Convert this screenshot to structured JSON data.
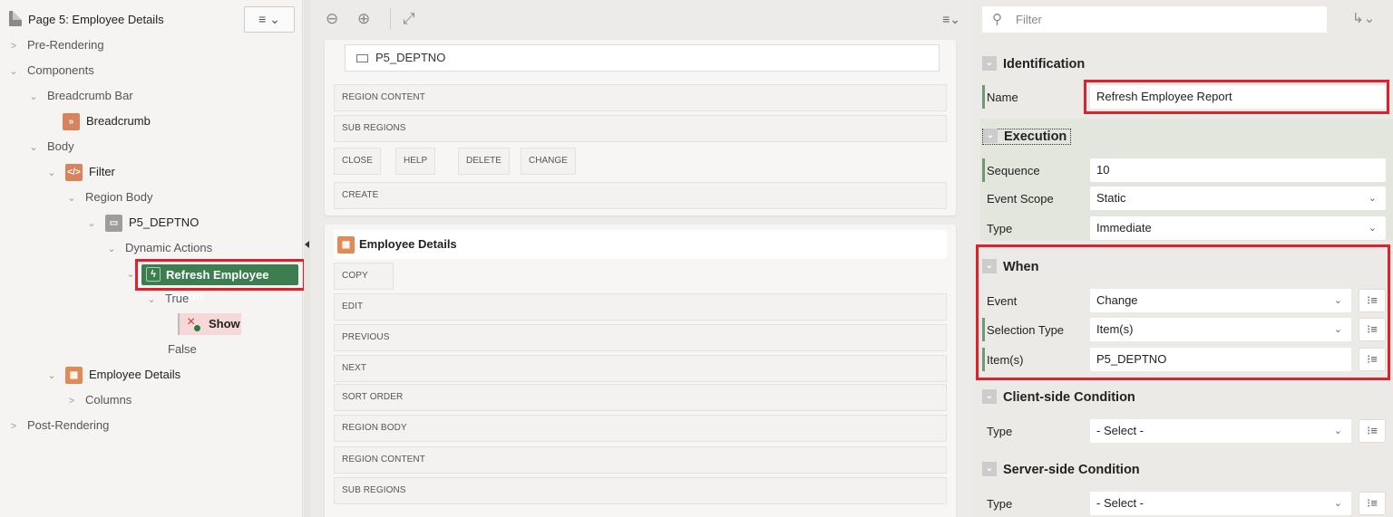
{
  "left": {
    "page_title": "Page 5: Employee Details",
    "menu_icon": "hamburger-chevron-icon",
    "tree": {
      "pre_rendering": "Pre-Rendering",
      "components": "Components",
      "breadcrumb_bar": "Breadcrumb Bar",
      "breadcrumb": "Breadcrumb",
      "body": "Body",
      "filter": "Filter",
      "region_body": "Region Body",
      "p5_deptno": "P5_DEPTNO",
      "dynamic_actions": "Dynamic Actions",
      "refresh_employee_report": "Refresh Employee Report",
      "true": "True",
      "show": "Show",
      "false": "False",
      "employee_details": "Employee Details",
      "columns": "Columns",
      "post_rendering": "Post-Rendering"
    }
  },
  "mid": {
    "toolbar": {
      "zoom_out": "⊖",
      "zoom_in": "⊕",
      "expand": "⤢",
      "menu": "≡⌄"
    },
    "region1": {
      "item": "P5_DEPTNO",
      "slots": {
        "region_content": "REGION CONTENT",
        "sub_regions": "SUB REGIONS",
        "create": "CREATE"
      },
      "buttons": {
        "close": "CLOSE",
        "help": "HELP",
        "delete": "DELETE",
        "change": "CHANGE"
      }
    },
    "region2": {
      "title": "Employee Details",
      "slots": {
        "copy": "COPY",
        "edit": "EDIT",
        "previous": "PREVIOUS",
        "next": "NEXT",
        "sort_order": "SORT ORDER",
        "region_body": "REGION BODY",
        "region_content": "REGION CONTENT",
        "sub_regions": "SUB REGIONS"
      }
    }
  },
  "right": {
    "filter_placeholder": "Filter",
    "identification": {
      "title": "Identification",
      "name_label": "Name",
      "name_value": "Refresh Employee Report"
    },
    "execution": {
      "title": "Execution",
      "sequence_label": "Sequence",
      "sequence_value": "10",
      "event_scope_label": "Event Scope",
      "event_scope_value": "Static",
      "type_label": "Type",
      "type_value": "Immediate"
    },
    "when": {
      "title": "When",
      "event_label": "Event",
      "event_value": "Change",
      "selection_type_label": "Selection Type",
      "selection_type_value": "Item(s)",
      "items_label": "Item(s)",
      "items_value": "P5_DEPTNO"
    },
    "client_condition": {
      "title": "Client-side Condition",
      "type_label": "Type",
      "type_value": "- Select -"
    },
    "server_condition": {
      "title": "Server-side Condition",
      "type_label": "Type",
      "type_value": "- Select -"
    }
  },
  "colors": {
    "highlight_red": "#e0202a",
    "dynamic_action_green": "#3d7e51",
    "show_action_pink": "#f7d8d8"
  }
}
